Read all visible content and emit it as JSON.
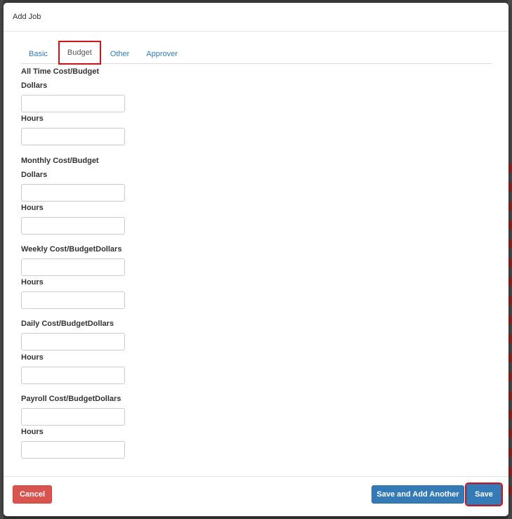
{
  "dialog": {
    "title": "Add Job"
  },
  "tabs": [
    {
      "label": "Basic"
    },
    {
      "label": "Budget"
    },
    {
      "label": "Other"
    },
    {
      "label": "Approver"
    }
  ],
  "active_tab": "Budget",
  "budget": {
    "all_time_heading": "All Time Cost/Budget",
    "all_time_dollars_label": "Dollars",
    "all_time_hours_label": "Hours",
    "monthly_heading": "Monthly Cost/Budget",
    "monthly_dollars_label": "Dollars",
    "monthly_hours_label": "Hours",
    "weekly_heading": "Weekly Cost/BudgetDollars",
    "weekly_hours_label": "Hours",
    "daily_heading": "Daily Cost/BudgetDollars",
    "daily_hours_label": "Hours",
    "payroll_heading": "Payroll Cost/BudgetDollars",
    "payroll_hours_label": "Hours"
  },
  "footer": {
    "cancel_label": "Cancel",
    "save_another_label": "Save and Add Another",
    "save_label": "Save"
  },
  "colors": {
    "primary": "#337ab7",
    "danger": "#d9534f",
    "highlight_outline": "#d0121b"
  }
}
